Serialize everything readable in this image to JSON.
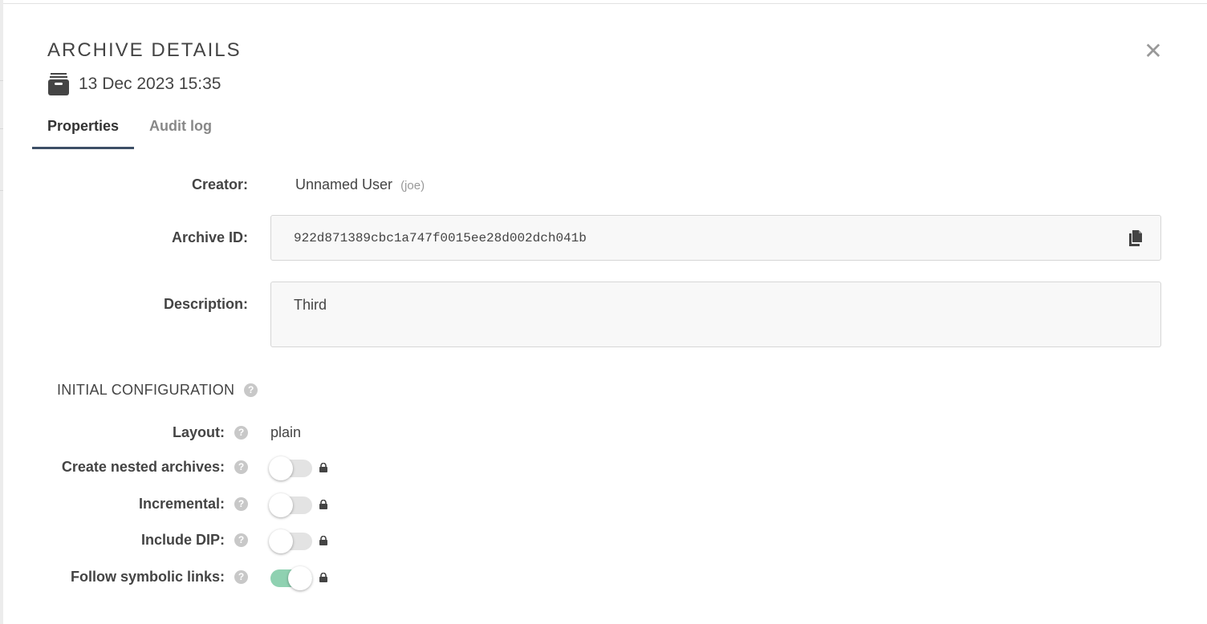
{
  "dialog": {
    "title": "ARCHIVE DETAILS",
    "date": "13 Dec 2023 15:35",
    "close_glyph": "✕",
    "icons": {
      "archive": "archive-box-icon",
      "close": "close-icon"
    }
  },
  "tabs": [
    {
      "label": "Properties",
      "active": true
    },
    {
      "label": "Audit log",
      "active": false
    }
  ],
  "properties": {
    "creator_label": "Creator:",
    "creator_name": "Unnamed User",
    "creator_username": "(joe)",
    "archive_id_label": "Archive ID:",
    "archive_id": "922d871389cbc1a747f0015ee28d002dch041b",
    "description_label": "Description:",
    "description": "Third"
  },
  "initial_configuration": {
    "title": "INITIAL CONFIGURATION",
    "help_glyph": "?",
    "layout_label": "Layout:",
    "layout_value": "plain",
    "options": [
      {
        "label": "Create nested archives:",
        "enabled": false,
        "locked": true
      },
      {
        "label": "Incremental:",
        "enabled": false,
        "locked": true
      },
      {
        "label": "Include DIP:",
        "enabled": false,
        "locked": true
      },
      {
        "label": "Follow symbolic links:",
        "enabled": true,
        "locked": true
      }
    ]
  },
  "colors": {
    "tab_active_underline": "#3d4f66",
    "toggle_on": "#8fd1b1",
    "toggle_off": "#e3e3e3"
  }
}
